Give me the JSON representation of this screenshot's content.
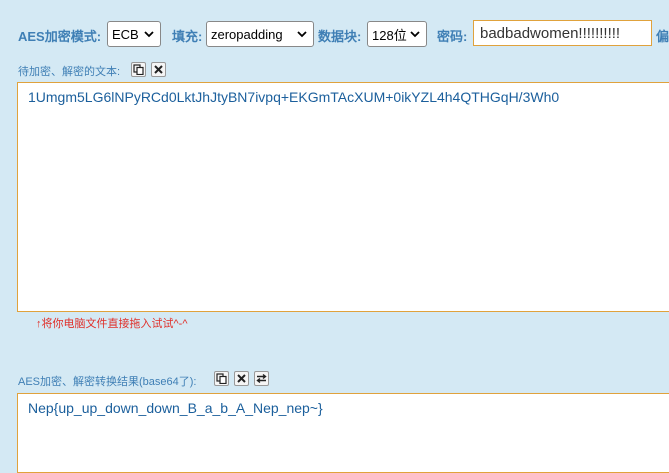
{
  "toolbar": {
    "mode_label": "AES加密模式:",
    "mode_value": "ECB",
    "padding_label": "填充:",
    "padding_value": "zeropadding",
    "block_label": "数据块:",
    "block_value": "128位",
    "password_label": "密码:",
    "password_value": "badbadwomen!!!!!!!!!!",
    "offset_label": "偏"
  },
  "input_section": {
    "label": "待加密、解密的文本:",
    "text": "1Umgm5LG6lNPyRCd0LktJhJtyBN7ivpq+EKGmTAcXUM+0ikYZL4h4QTHGqH/3Wh0",
    "hint": "↑将你电脑文件直接拖入试试^-^"
  },
  "output_section": {
    "label": "AES加密、解密转换结果(base64了):",
    "text": "Nep{up_up_down_down_B_a_b_A_Nep_nep~}"
  },
  "colors": {
    "background": "#d4e9f4",
    "label": "#3f7fb5",
    "text_area_border": "#e0a23c",
    "hint": "#e0302a"
  }
}
